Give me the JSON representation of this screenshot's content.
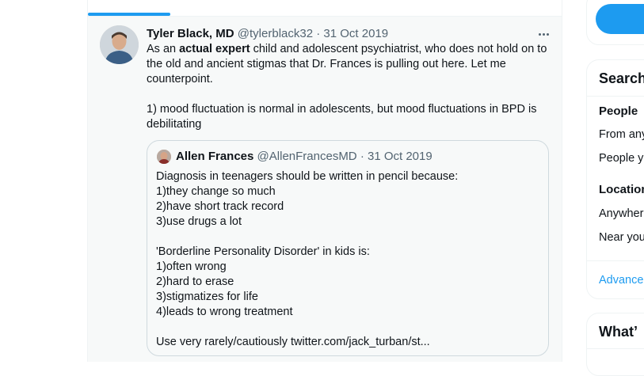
{
  "tweet": {
    "author_name": "Tyler Black, MD",
    "author_handle": "@tylerblack32",
    "separator": "·",
    "date": "31 Oct 2019",
    "body_intro": "As an ",
    "body_bold": "actual expert",
    "body_rest": " child and adolescent psychiatrist, who does not hold on to the old and ancient stigmas that Dr. Frances is pulling out here.  Let me counterpoint.",
    "body_point": "1) mood fluctuation is normal in adolescents, but mood fluctuations in BPD is debilitating"
  },
  "quoted_tweet": {
    "author_name": "Allen Frances",
    "author_handle": "@AllenFrancesMD",
    "separator": "·",
    "date": "31 Oct 2019",
    "lines_a": [
      "Diagnosis in teenagers should be written in pencil because:",
      "1)they change so much",
      "2)have short track record",
      "3)use drugs a lot"
    ],
    "lines_b": [
      "'Borderline Personality Disorder' in kids is:",
      "1)often wrong",
      "2)hard to erase",
      "3)stigmatizes for life",
      "4)leads to wrong treatment"
    ],
    "last_line": "Use very rarely/cautiously twitter.com/jack_turban/st..."
  },
  "sidebar": {
    "search_filters_title": "Search",
    "people_heading": "People",
    "people_options": [
      "From any",
      "People y"
    ],
    "location_heading": "Location",
    "location_options": [
      "Anywhere",
      "Near you"
    ],
    "advanced_link": "Advance",
    "whats_title": "What’"
  },
  "colors": {
    "accent": "#1d9bf0",
    "text": "#0f1419",
    "muted": "#536471"
  }
}
